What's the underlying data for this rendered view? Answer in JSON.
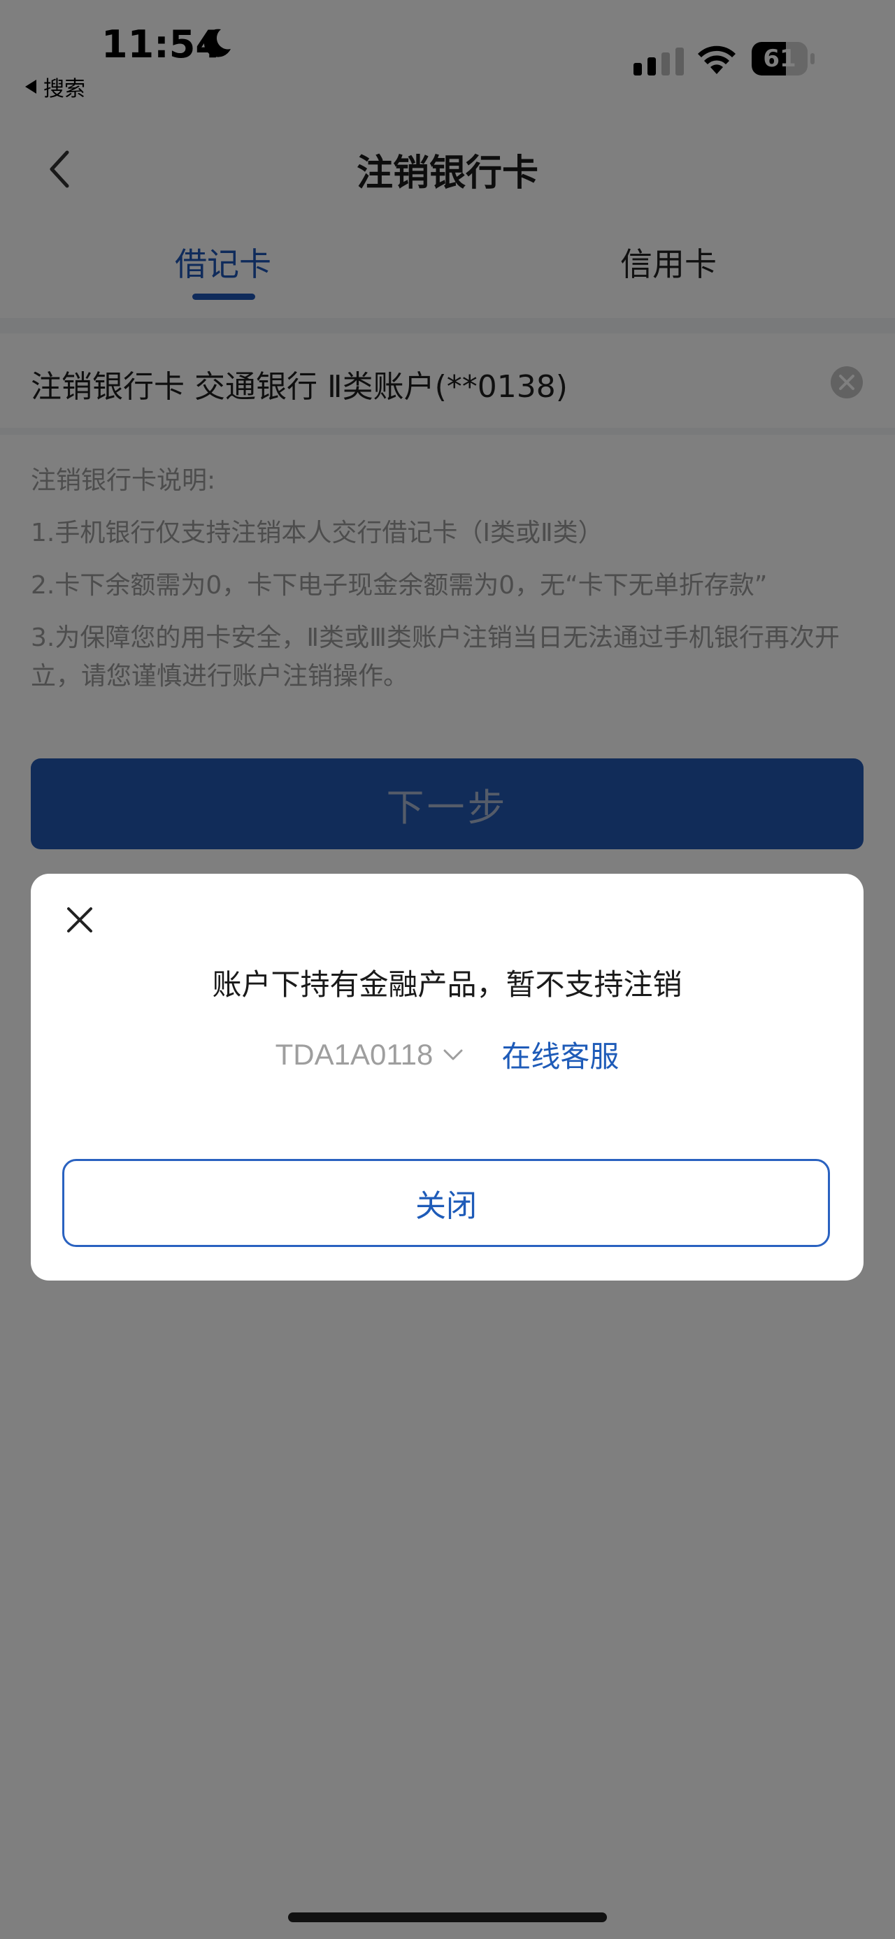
{
  "status_bar": {
    "time": "11:54",
    "back_app": "搜索",
    "battery_level": "61"
  },
  "header": {
    "title": "注销银行卡"
  },
  "tabs": [
    {
      "label": "借记卡",
      "active": true
    },
    {
      "label": "信用卡",
      "active": false
    }
  ],
  "card_row": {
    "text": "注销银行卡  交通银行 Ⅱ类账户(**0138)"
  },
  "notes": {
    "title": "注销银行卡说明:",
    "items": [
      "1.手机银行仅支持注销本人交行借记卡（Ⅰ类或Ⅱ类）",
      "2.卡下余额需为0，卡下电子现金余额需为0，无“卡下无单折存款”",
      "3.为保障您的用卡安全，Ⅱ类或Ⅲ类账户注销当日无法通过手机银行再次开立，请您谨慎进行账户注销操作。"
    ]
  },
  "next_button": {
    "label": "下一步"
  },
  "dialog": {
    "message": "账户下持有金融产品，暂不支持注销",
    "code": "TDA1A0118",
    "service_link": "在线客服",
    "close_button": "关闭"
  },
  "colors": {
    "accent": "#1e56b6",
    "button_fill": "#2358b3",
    "overlay": "rgba(0,0,0,0.5)"
  },
  "icons": [
    "moon-icon",
    "back-triangle-icon",
    "signal-icon",
    "wifi-icon",
    "battery-icon",
    "back-chevron-icon",
    "clear-icon",
    "close-icon",
    "chevron-down-icon"
  ]
}
